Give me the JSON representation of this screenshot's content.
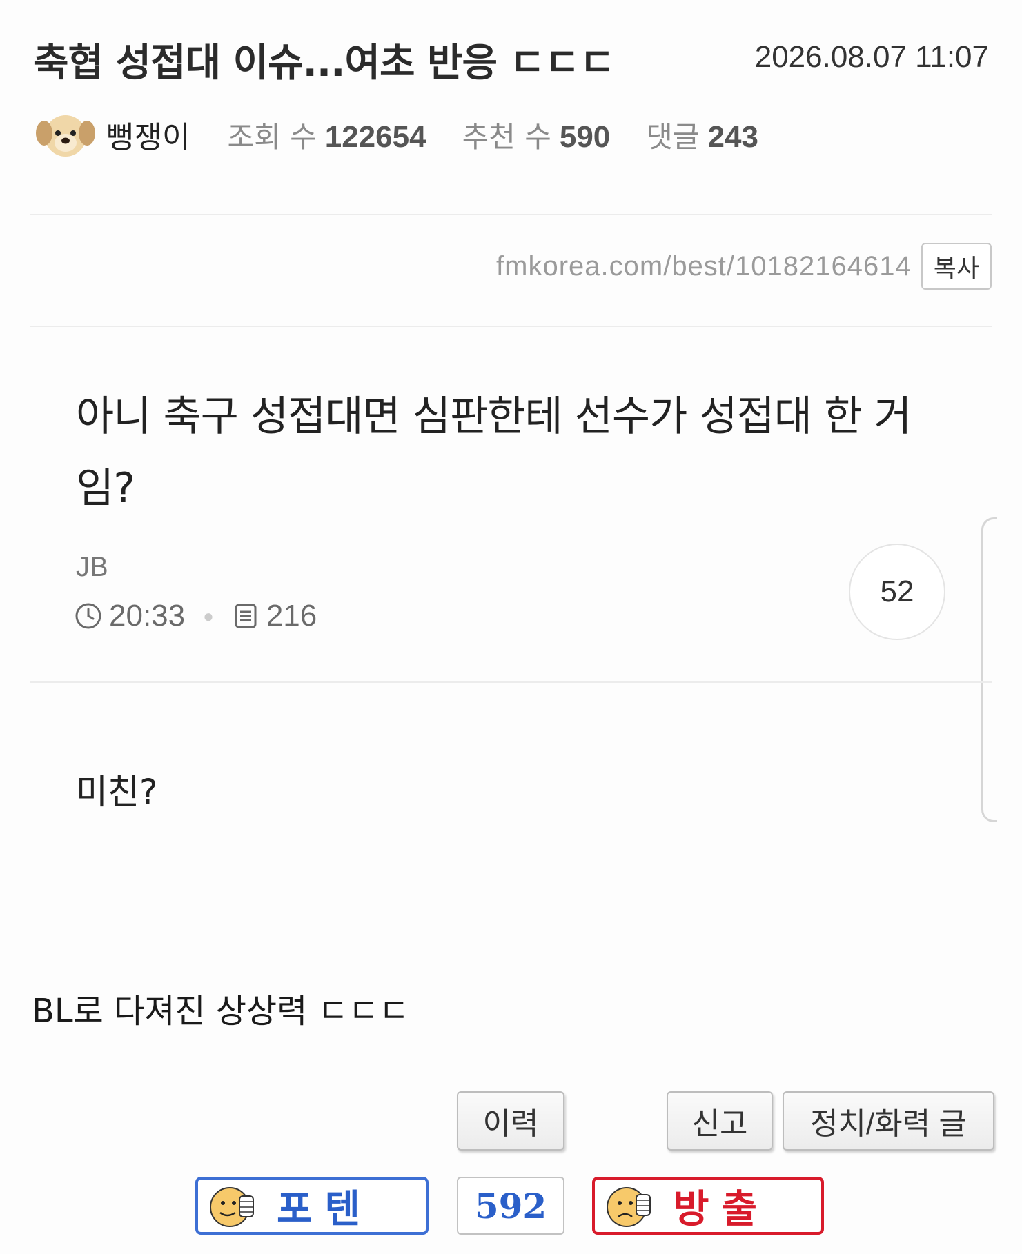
{
  "post": {
    "title": "축협 성접대 이슈...여초 반응 ㄷㄷㄷ",
    "date": "2026.08.07 11:07",
    "author": "뻥쟁이",
    "views_label": "조회 수",
    "views": "122654",
    "recommend_label": "추천 수",
    "recommend": "590",
    "comments_label": "댓글",
    "comments": "243"
  },
  "url": {
    "text": "fmkorea.com/best/10182164614",
    "copy_label": "복사"
  },
  "embedded": {
    "title": "아니 축구 성접대면 심판한테 선수가 성접대 한 거임?",
    "author": "JB",
    "time": "20:33",
    "views": "216",
    "comment_count": "52",
    "body": "미친?"
  },
  "caption": "BL로 다져진 상상력 ㄷㄷㄷ",
  "buttons": {
    "history": "이력",
    "report": "신고",
    "politics": "정치/화력 글"
  },
  "vote": {
    "up_label": "포텐",
    "count": "592",
    "down_label": "방출",
    "up_color": "#2a5fc9",
    "down_color": "#d81b2b"
  },
  "icons": {
    "avatar": "puppy-avatar-icon",
    "clock": "clock-icon",
    "views": "document-icon",
    "vote_up": "thumbs-up-face-icon",
    "vote_down": "thumbs-down-face-icon"
  }
}
